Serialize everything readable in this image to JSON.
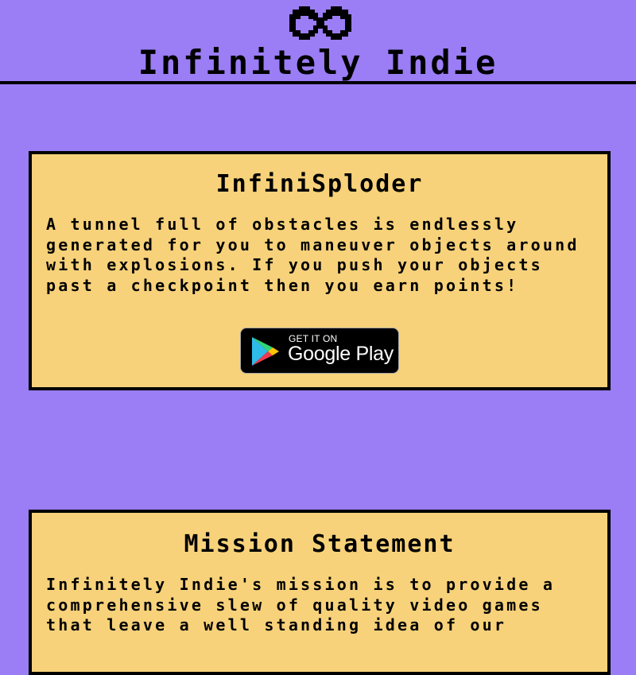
{
  "header": {
    "site_title": "Infinitely Indie",
    "logo_icon": "infinity-logo-icon"
  },
  "game_card": {
    "title": "InfiniSploder",
    "description": "A tunnel full of obstacles is endlessly generated for you to maneuver objects around with explosions. If you push your objects past a checkpoint then you earn points!",
    "badge": {
      "small_text": "GET IT ON",
      "big_text": "Google Play",
      "icon": "google-play-icon"
    }
  },
  "mission_card": {
    "title": "Mission Statement",
    "text": "Infinitely Indie's mission is to provide a comprehensive slew of quality video games that leave a well standing idea of our"
  },
  "colors": {
    "background": "#9b7df5",
    "card": "#f7d27a",
    "border": "#000000"
  }
}
